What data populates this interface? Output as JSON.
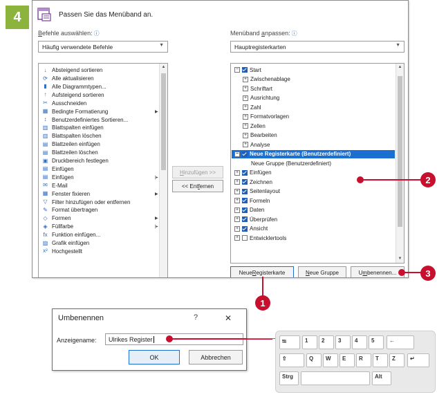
{
  "step": "4",
  "dialog": {
    "title": "Passen Sie das Menüband an.",
    "left_label": "Befehle auswählen:",
    "left_label_accel": "B",
    "left_label_rest": "efehle auswählen:",
    "info_glyph": "ⓘ",
    "left_combo_value": "Häufig verwendete Befehle",
    "right_label": "Menüband anpassen:",
    "right_label_pre": "Menüband ",
    "right_label_accel": "a",
    "right_label_rest": "npassen:",
    "right_combo_value": "Hauptregisterkarten",
    "commands": [
      {
        "label": "Absteigend sortieren",
        "icon": "sort-desc-icon",
        "glyph": "↓",
        "sub": ""
      },
      {
        "label": "Alle aktualisieren",
        "icon": "refresh-all-icon",
        "glyph": "⟳",
        "sub": ""
      },
      {
        "label": "Alle Diagrammtypen...",
        "icon": "chart-types-icon",
        "glyph": "▮",
        "sub": ""
      },
      {
        "label": "Aufsteigend sortieren",
        "icon": "sort-asc-icon",
        "glyph": "↑",
        "sub": ""
      },
      {
        "label": "Ausschneiden",
        "icon": "scissors-icon",
        "glyph": "✂",
        "sub": ""
      },
      {
        "label": "Bedingte Formatierung",
        "icon": "conditional-format-icon",
        "glyph": "▦",
        "sub": "▶"
      },
      {
        "label": "Benutzerdefiniertes Sortieren...",
        "icon": "custom-sort-icon",
        "glyph": "↕",
        "sub": ""
      },
      {
        "label": "Blattspalten einfügen",
        "icon": "insert-columns-icon",
        "glyph": "▥",
        "sub": ""
      },
      {
        "label": "Blattspalten löschen",
        "icon": "delete-columns-icon",
        "glyph": "▥",
        "sub": ""
      },
      {
        "label": "Blattzeilen einfügen",
        "icon": "insert-rows-icon",
        "glyph": "▤",
        "sub": ""
      },
      {
        "label": "Blattzeilen löschen",
        "icon": "delete-rows-icon",
        "glyph": "▤",
        "sub": ""
      },
      {
        "label": "Druckbereich festlegen",
        "icon": "print-area-icon",
        "glyph": "▣",
        "sub": ""
      },
      {
        "label": "Einfügen",
        "icon": "paste-icon",
        "glyph": "▤",
        "sub": ""
      },
      {
        "label": "Einfügen",
        "icon": "paste-options-icon",
        "glyph": "▤",
        "sub": "|▸"
      },
      {
        "label": "E-Mail",
        "icon": "email-icon",
        "glyph": "✉",
        "sub": ""
      },
      {
        "label": "Fenster fixieren",
        "icon": "freeze-panes-icon",
        "glyph": "▦",
        "sub": "▶"
      },
      {
        "label": "Filter hinzufügen oder entfernen",
        "icon": "filter-icon",
        "glyph": "▽",
        "sub": ""
      },
      {
        "label": "Format übertragen",
        "icon": "format-painter-icon",
        "glyph": "✎",
        "sub": ""
      },
      {
        "label": "Formen",
        "icon": "shapes-icon",
        "glyph": "◇",
        "sub": "▶"
      },
      {
        "label": "Füllfarbe",
        "icon": "fill-color-icon",
        "glyph": "◈",
        "sub": "|▸"
      },
      {
        "label": "Funktion einfügen...",
        "icon": "function-icon",
        "glyph": "fx",
        "sub": ""
      },
      {
        "label": "Grafik einfügen",
        "icon": "insert-picture-icon",
        "glyph": "▨",
        "sub": ""
      },
      {
        "label": "Hochgestellt",
        "icon": "superscript-icon",
        "glyph": "x²",
        "sub": ""
      }
    ],
    "tree": [
      {
        "label": "Start",
        "indent": 0,
        "expander": "⊟",
        "checkbox": "checked",
        "selected": false
      },
      {
        "label": "Zwischenablage",
        "indent": 1,
        "expander": "⊞",
        "checkbox": "none",
        "selected": false
      },
      {
        "label": "Schriftart",
        "indent": 1,
        "expander": "⊞",
        "checkbox": "none",
        "selected": false
      },
      {
        "label": "Ausrichtung",
        "indent": 1,
        "expander": "⊞",
        "checkbox": "none",
        "selected": false
      },
      {
        "label": "Zahl",
        "indent": 1,
        "expander": "⊞",
        "checkbox": "none",
        "selected": false
      },
      {
        "label": "Formatvorlagen",
        "indent": 1,
        "expander": "⊞",
        "checkbox": "none",
        "selected": false
      },
      {
        "label": "Zellen",
        "indent": 1,
        "expander": "⊞",
        "checkbox": "none",
        "selected": false
      },
      {
        "label": "Bearbeiten",
        "indent": 1,
        "expander": "⊞",
        "checkbox": "none",
        "selected": false
      },
      {
        "label": "Analyse",
        "indent": 1,
        "expander": "⊞",
        "checkbox": "none",
        "selected": false
      },
      {
        "label": "Neue Registerkarte (Benutzerdefiniert)",
        "indent": 0,
        "expander": "⊟",
        "checkbox": "checked",
        "selected": true
      },
      {
        "label": "Neue Gruppe (Benutzerdefiniert)",
        "indent": 2,
        "expander": "",
        "checkbox": "none",
        "selected": false
      },
      {
        "label": "Einfügen",
        "indent": 0,
        "expander": "⊞",
        "checkbox": "checked",
        "selected": false
      },
      {
        "label": "Zeichnen",
        "indent": 0,
        "expander": "⊞",
        "checkbox": "checked",
        "selected": false
      },
      {
        "label": "Seitenlayout",
        "indent": 0,
        "expander": "⊞",
        "checkbox": "checked",
        "selected": false
      },
      {
        "label": "Formeln",
        "indent": 0,
        "expander": "⊞",
        "checkbox": "checked",
        "selected": false
      },
      {
        "label": "Daten",
        "indent": 0,
        "expander": "⊞",
        "checkbox": "checked",
        "selected": false
      },
      {
        "label": "Überprüfen",
        "indent": 0,
        "expander": "⊞",
        "checkbox": "checked",
        "selected": false
      },
      {
        "label": "Ansicht",
        "indent": 0,
        "expander": "⊞",
        "checkbox": "checked",
        "selected": false
      },
      {
        "label": "Entwicklertools",
        "indent": 0,
        "expander": "⊞",
        "checkbox": "unchecked",
        "selected": false
      }
    ],
    "add_button": "Hinzufügen >>",
    "add_accel": "H",
    "add_rest": "inzufügen >>",
    "remove_button": "<< Entfernen",
    "remove_pre": "<< Ent",
    "remove_accel": "f",
    "remove_rest": "ernen",
    "new_tab_button": "Neue Registerkarte",
    "new_tab_pre": "Neue ",
    "new_tab_accel": "R",
    "new_tab_rest": "egisterkarte",
    "new_group_button": "Neue Gruppe",
    "new_group_pre": "",
    "new_group_accel": "N",
    "new_group_rest": "eue Gruppe",
    "rename_button": "Umbenennen...",
    "rename_pre": "U",
    "rename_accel": "m",
    "rename_rest": "benennen..."
  },
  "callouts": [
    "1",
    "2",
    "3"
  ],
  "rename_dialog": {
    "title": "Umbenennen",
    "help": "?",
    "close": "✕",
    "field_label": "Anzeigename:",
    "field_value": "Ulrikes Register",
    "ok": "OK",
    "cancel": "Abbrechen"
  },
  "keyboard": {
    "row1": [
      "⭾",
      "1",
      "2",
      "3",
      "4",
      "5",
      "←"
    ],
    "row2": [
      "⇧",
      "Q",
      "W",
      "E",
      "R",
      "T",
      "Z"
    ],
    "row3": [
      "Strg",
      "",
      "Alt",
      "↵"
    ]
  },
  "colors": {
    "accent_green": "#8cb43c",
    "callout_red": "#c8102e",
    "selection_blue": "#1a6fd0"
  }
}
